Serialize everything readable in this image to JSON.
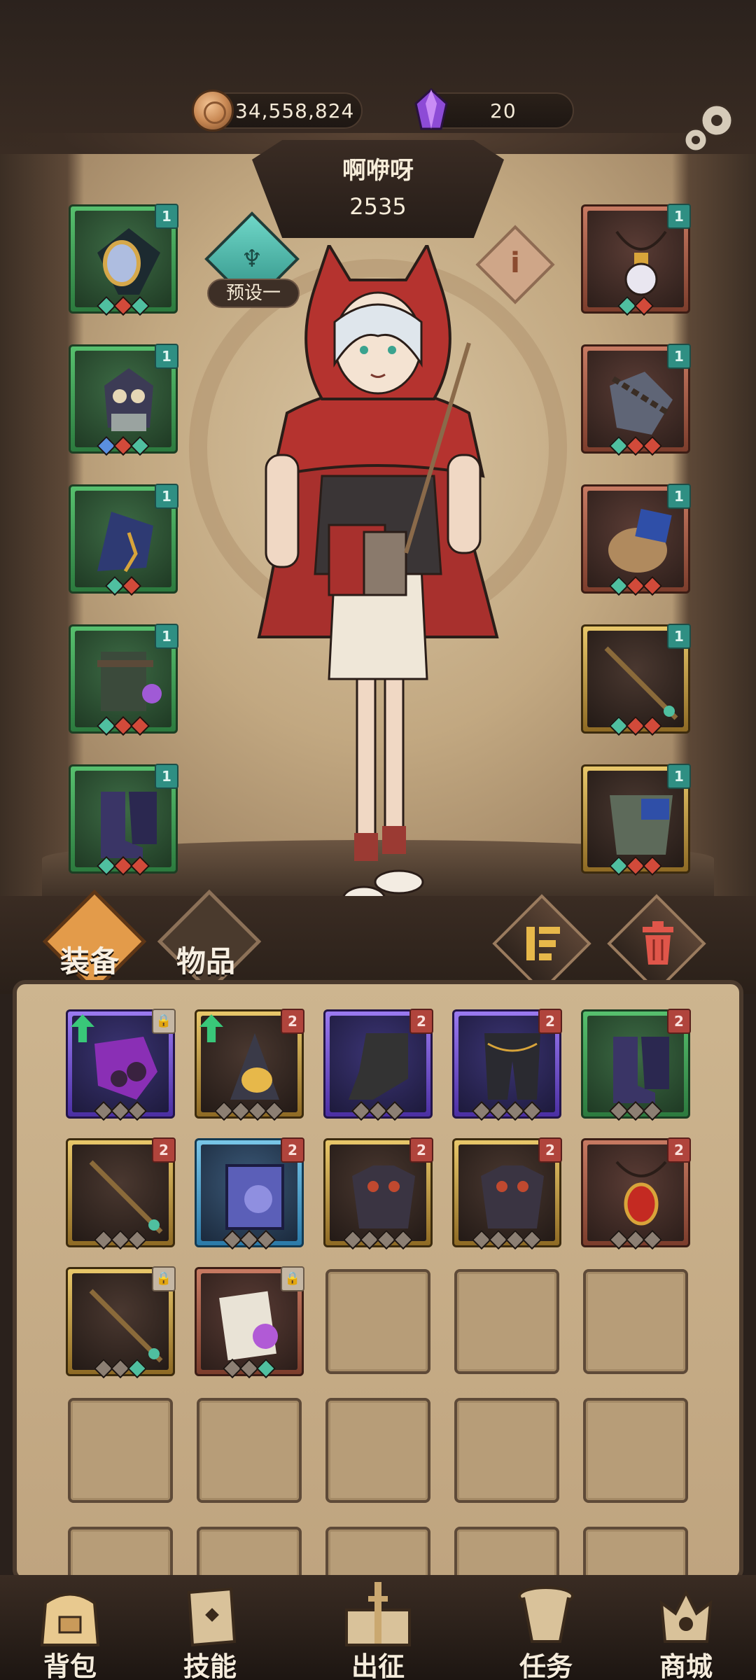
{
  "resources": {
    "coins": "34,558,824",
    "gems": "20"
  },
  "character": {
    "name": "啊咿呀",
    "power": "2535",
    "preset_label": "预设一"
  },
  "equipped_left": [
    {
      "rarity": "green",
      "tag": "1",
      "gems": [
        "g",
        "r",
        "g"
      ]
    },
    {
      "rarity": "green",
      "tag": "1",
      "gems": [
        "b",
        "r",
        "g"
      ]
    },
    {
      "rarity": "green",
      "tag": "1",
      "gems": [
        "g",
        "r"
      ]
    },
    {
      "rarity": "green",
      "tag": "1",
      "gems": [
        "g",
        "r",
        "r"
      ]
    },
    {
      "rarity": "green",
      "tag": "1",
      "gems": [
        "g",
        "r",
        "r"
      ]
    }
  ],
  "equipped_right": [
    {
      "rarity": "red",
      "tag": "1",
      "gems": [
        "g",
        "r"
      ]
    },
    {
      "rarity": "red",
      "tag": "1",
      "gems": [
        "g",
        "r",
        "r"
      ]
    },
    {
      "rarity": "red",
      "tag": "1",
      "gems": [
        "g",
        "r",
        "r"
      ]
    },
    {
      "rarity": "gold",
      "tag": "1",
      "gems": [
        "g",
        "r",
        "r"
      ]
    },
    {
      "rarity": "gold",
      "tag": "1",
      "gems": [
        "g",
        "r",
        "r"
      ]
    }
  ],
  "tabs": {
    "equipment": "装备",
    "items": "物品"
  },
  "inventory": [
    {
      "rarity": "purple",
      "tag": "lock",
      "upgrade": true
    },
    {
      "rarity": "gold",
      "tag": "2",
      "upgrade": true
    },
    {
      "rarity": "purple",
      "tag": "2",
      "upgrade": false
    },
    {
      "rarity": "purple",
      "tag": "2",
      "upgrade": false
    },
    {
      "rarity": "green",
      "tag": "2",
      "upgrade": false
    },
    {
      "rarity": "gold",
      "tag": "2",
      "upgrade": false
    },
    {
      "rarity": "blue",
      "tag": "2",
      "upgrade": false
    },
    {
      "rarity": "gold",
      "tag": "2",
      "upgrade": false
    },
    {
      "rarity": "gold",
      "tag": "2",
      "upgrade": false
    },
    {
      "rarity": "red",
      "tag": "2",
      "upgrade": false
    },
    {
      "rarity": "gold",
      "tag": "lock",
      "upgrade": false
    },
    {
      "rarity": "red",
      "tag": "lock",
      "upgrade": false
    }
  ],
  "nav": {
    "bag": "背包",
    "skills": "技能",
    "expedition": "出征",
    "tasks": "任务",
    "shop": "商城"
  },
  "colors": {
    "accent_teal": "#2f8f83",
    "tag_red": "#b0443c",
    "upgrade_green": "#39c779"
  }
}
